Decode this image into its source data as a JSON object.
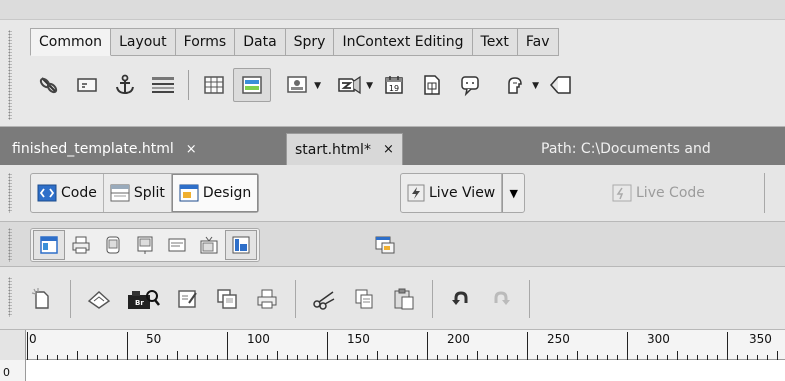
{
  "insert_panel": {
    "categories": [
      "Common",
      "Layout",
      "Forms",
      "Data",
      "Spry",
      "InContext Editing",
      "Text",
      "Fav"
    ],
    "active_category": "Common",
    "icons": [
      "hyperlink-icon",
      "email-link-icon",
      "named-anchor-icon",
      "horizontal-rule-icon",
      "table-icon",
      "insert-div-icon",
      "images-icon",
      "media-icon",
      "date-icon",
      "server-side-include-icon",
      "comment-icon",
      "head-icon",
      "script-icon"
    ]
  },
  "document_tabs": {
    "tabs": [
      {
        "label": "finished_template.html",
        "close": "×"
      },
      {
        "label": "start.html*",
        "close": "×"
      }
    ],
    "active": "start.html*",
    "path_text": "Path:  C:\\Documents and"
  },
  "doc_toolbar": {
    "code_label": "Code",
    "split_label": "Split",
    "design_label": "Design",
    "live_view_label": "Live View",
    "live_code_label": "Live Code",
    "active_view": "Design"
  },
  "style_toolbar": {
    "icons": [
      "screen-media-icon",
      "print-media-icon",
      "handheld-media-icon",
      "projection-media-icon",
      "tty-media-icon",
      "tv-media-icon",
      "toggle-css-styles-icon",
      "design-time-stylesheets-icon"
    ]
  },
  "standard_toolbar": {
    "icons": [
      "new-document-icon",
      "open-icon",
      "browse-in-bridge-icon",
      "save-icon",
      "save-all-icon",
      "print-code-icon",
      "cut-icon",
      "copy-icon",
      "paste-icon",
      "undo-icon",
      "redo-icon"
    ]
  },
  "ruler": {
    "labels": [
      "0",
      "50",
      "100",
      "150",
      "200",
      "250",
      "300",
      "350"
    ],
    "vertical_label": "0"
  },
  "colors": {
    "doc_tab_bar": "#7b7b7b",
    "toolbar_bg": "#e6e6e6",
    "accent_blue": "#2e6fc9"
  }
}
